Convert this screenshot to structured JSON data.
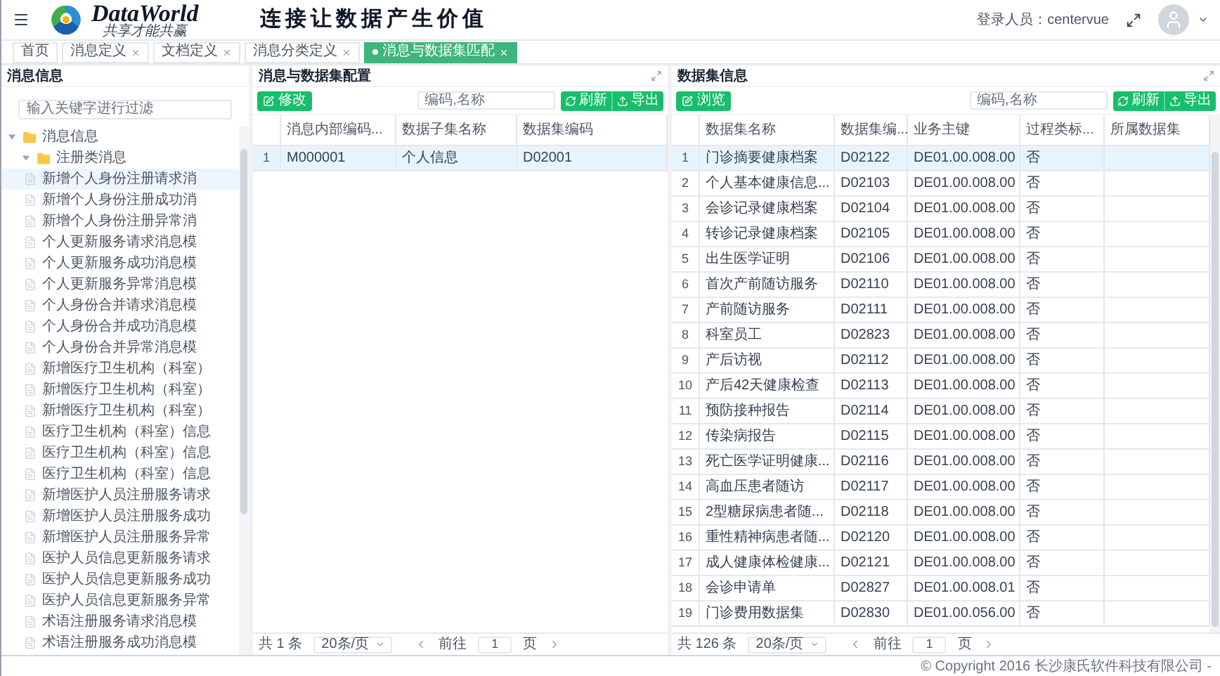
{
  "header": {
    "logo_text": "DataWorld",
    "logo_subtitle": "共享才能共赢",
    "slogan": "连接让数据产生价值",
    "user_label": "登录人员：centervue"
  },
  "tabs": [
    {
      "label": "首页",
      "selected": false,
      "closable": false
    },
    {
      "label": "消息定义",
      "selected": false,
      "closable": true
    },
    {
      "label": "文档定义",
      "selected": false,
      "closable": true
    },
    {
      "label": "消息分类定义",
      "selected": false,
      "closable": true
    },
    {
      "label": "消息与数据集匹配",
      "selected": true,
      "closable": true
    }
  ],
  "left_panel": {
    "title": "消息信息",
    "filter_placeholder": "输入关键字进行过滤",
    "tree": [
      {
        "label": "消息信息",
        "expanded": true,
        "children": [
          {
            "label": "注册类消息",
            "expanded": true,
            "children": [
              {
                "label": "新增个人身份注册请求消",
                "selected": true
              },
              {
                "label": "新增个人身份注册成功消",
                "selected": false
              },
              {
                "label": "新增个人身份注册异常消",
                "selected": false
              },
              {
                "label": "个人更新服务请求消息模",
                "selected": false
              },
              {
                "label": "个人更新服务成功消息模",
                "selected": false
              },
              {
                "label": "个人更新服务异常消息模",
                "selected": false
              },
              {
                "label": "个人身份合并请求消息模",
                "selected": false
              },
              {
                "label": "个人身份合并成功消息模",
                "selected": false
              },
              {
                "label": "个人身份合并异常消息模",
                "selected": false
              },
              {
                "label": "新增医疗卫生机构（科室）",
                "selected": false
              },
              {
                "label": "新增医疗卫生机构（科室）",
                "selected": false
              },
              {
                "label": "新增医疗卫生机构（科室）",
                "selected": false
              },
              {
                "label": "医疗卫生机构（科室）信息",
                "selected": false
              },
              {
                "label": "医疗卫生机构（科室）信息",
                "selected": false
              },
              {
                "label": "医疗卫生机构（科室）信息",
                "selected": false
              },
              {
                "label": "新增医护人员注册服务请求",
                "selected": false
              },
              {
                "label": "新增医护人员注册服务成功",
                "selected": false
              },
              {
                "label": "新增医护人员注册服务异常",
                "selected": false
              },
              {
                "label": "医护人员信息更新服务请求",
                "selected": false
              },
              {
                "label": "医护人员信息更新服务成功",
                "selected": false
              },
              {
                "label": "医护人员信息更新服务异常",
                "selected": false
              },
              {
                "label": "术语注册服务请求消息模",
                "selected": false
              },
              {
                "label": "术语注册服务成功消息模",
                "selected": false
              }
            ]
          }
        ]
      }
    ]
  },
  "middle_panel": {
    "title": "消息与数据集配置",
    "action_button": "修改",
    "search_placeholder": "编码,名称",
    "refresh_button": "刷新",
    "export_button": "导出",
    "columns": [
      "消息内部编码...",
      "数据子集名称",
      "数据集编码"
    ],
    "rows": [
      {
        "index": "1",
        "cells": [
          "M000001",
          "个人信息",
          "D02001"
        ],
        "selected": true
      }
    ],
    "pager": {
      "total": "共 1 条",
      "page_size": "20条/页",
      "goto_label": "前往",
      "page": "1",
      "page_unit": "页"
    }
  },
  "right_panel": {
    "title": "数据集信息",
    "action_button": "浏览",
    "search_placeholder": "编码,名称",
    "refresh_button": "刷新",
    "export_button": "导出",
    "columns": [
      "数据集名称",
      "数据集编...",
      "业务主键",
      "过程类标...",
      "所属数据集"
    ],
    "rows": [
      {
        "index": "1",
        "cells": [
          "门诊摘要健康档案",
          "D02122",
          "DE01.00.008.00",
          "否",
          ""
        ],
        "selected": true
      },
      {
        "index": "2",
        "cells": [
          "个人基本健康信息...",
          "D02103",
          "DE01.00.008.00",
          "否",
          ""
        ],
        "selected": false
      },
      {
        "index": "3",
        "cells": [
          "会诊记录健康档案",
          "D02104",
          "DE01.00.008.00",
          "否",
          ""
        ],
        "selected": false
      },
      {
        "index": "4",
        "cells": [
          "转诊记录健康档案",
          "D02105",
          "DE01.00.008.00",
          "否",
          ""
        ],
        "selected": false
      },
      {
        "index": "5",
        "cells": [
          "出生医学证明",
          "D02106",
          "DE01.00.008.00",
          "否",
          ""
        ],
        "selected": false
      },
      {
        "index": "6",
        "cells": [
          "首次产前随访服务",
          "D02110",
          "DE01.00.008.00",
          "否",
          ""
        ],
        "selected": false
      },
      {
        "index": "7",
        "cells": [
          "产前随访服务",
          "D02111",
          "DE01.00.008.00",
          "否",
          ""
        ],
        "selected": false
      },
      {
        "index": "8",
        "cells": [
          "科室员工",
          "D02823",
          "DE01.00.008.00",
          "否",
          ""
        ],
        "selected": false
      },
      {
        "index": "9",
        "cells": [
          "产后访视",
          "D02112",
          "DE01.00.008.00",
          "否",
          ""
        ],
        "selected": false
      },
      {
        "index": "10",
        "cells": [
          "产后42天健康检查",
          "D02113",
          "DE01.00.008.00",
          "否",
          ""
        ],
        "selected": false
      },
      {
        "index": "11",
        "cells": [
          "预防接种报告",
          "D02114",
          "DE01.00.008.00",
          "否",
          ""
        ],
        "selected": false
      },
      {
        "index": "12",
        "cells": [
          "传染病报告",
          "D02115",
          "DE01.00.008.00",
          "否",
          ""
        ],
        "selected": false
      },
      {
        "index": "13",
        "cells": [
          "死亡医学证明健康...",
          "D02116",
          "DE01.00.008.00",
          "否",
          ""
        ],
        "selected": false
      },
      {
        "index": "14",
        "cells": [
          "高血压患者随访",
          "D02117",
          "DE01.00.008.00",
          "否",
          ""
        ],
        "selected": false
      },
      {
        "index": "15",
        "cells": [
          "2型糖尿病患者随...",
          "D02118",
          "DE01.00.008.00",
          "否",
          ""
        ],
        "selected": false
      },
      {
        "index": "16",
        "cells": [
          "重性精神病患者随...",
          "D02120",
          "DE01.00.008.00",
          "否",
          ""
        ],
        "selected": false
      },
      {
        "index": "17",
        "cells": [
          "成人健康体检健康...",
          "D02121",
          "DE01.00.008.00",
          "否",
          ""
        ],
        "selected": false
      },
      {
        "index": "18",
        "cells": [
          "会诊申请单",
          "D02827",
          "DE01.00.008.01",
          "否",
          ""
        ],
        "selected": false
      },
      {
        "index": "19",
        "cells": [
          "门诊费用数据集",
          "D02830",
          "DE01.00.056.00",
          "否",
          ""
        ],
        "selected": false
      }
    ],
    "pager": {
      "total": "共 126 条",
      "page_size": "20条/页",
      "goto_label": "前往",
      "page": "1",
      "page_unit": "页"
    }
  },
  "footer": {
    "copyright": "© Copyright 2016 长沙康氏软件科技有限公司 -"
  }
}
